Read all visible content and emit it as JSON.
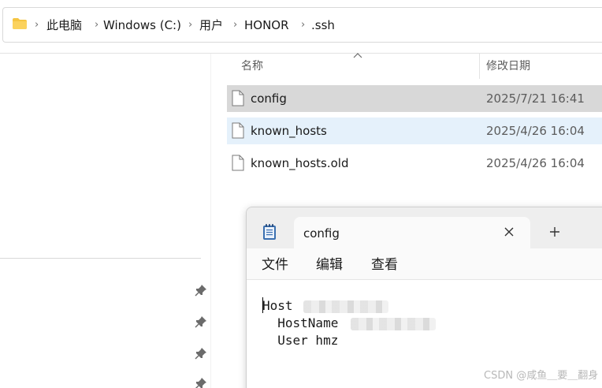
{
  "address_bar": {
    "icon": "folder-icon",
    "breadcrumbs": [
      "此电脑",
      "Windows (C:)",
      "用户",
      "HONOR",
      ".ssh"
    ]
  },
  "file_list": {
    "columns": {
      "name": "名称",
      "date_modified": "修改日期"
    },
    "sort_indicator": "caret-up-icon",
    "files": [
      {
        "name": "config",
        "date": "2025/7/21 16:41",
        "state": "selected"
      },
      {
        "name": "known_hosts",
        "date": "2025/4/26 16:04",
        "state": "hover"
      },
      {
        "name": "known_hosts.old",
        "date": "2025/4/26 16:04",
        "state": "normal"
      }
    ]
  },
  "nav_pane": {
    "pins": [
      "pin-icon",
      "pin-icon",
      "pin-icon",
      "pin-icon"
    ]
  },
  "notepad": {
    "app_icon": "notepad-icon",
    "tab_title": "config",
    "close_icon": "close-icon",
    "new_tab_icon": "plus-icon",
    "menu": [
      "文件",
      "编辑",
      "查看"
    ],
    "lines": [
      {
        "text": "Host",
        "redacted": true
      },
      {
        "text": "  HostName",
        "redacted": true
      },
      {
        "text": "  User hmz",
        "redacted": false
      }
    ]
  },
  "watermark": "CSDN @咸鱼＿要＿翻身",
  "colors": {
    "selected_row": "#d8d8d8",
    "hover_row": "#e5f1fb",
    "folder": "#f5c542"
  }
}
